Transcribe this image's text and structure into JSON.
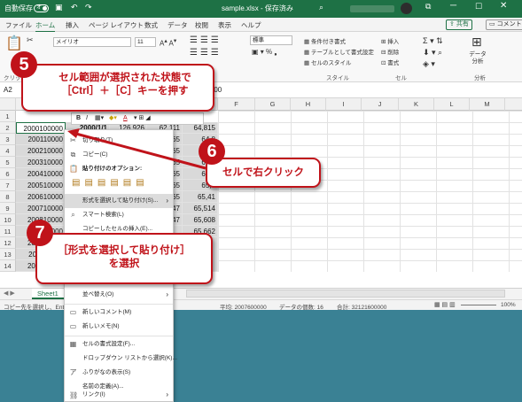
{
  "titlebar": {
    "autosave_label": "自動保存",
    "autosave_state": "オフ",
    "filename": "sample.xlsx - 保存済み"
  },
  "tabs": [
    "ファイル",
    "ホーム",
    "挿入",
    "ページ レイアウト",
    "数式",
    "データ",
    "校閲",
    "表示",
    "ヘルプ"
  ],
  "share_label": "共有",
  "comment_label": "コメント",
  "ribbon": {
    "font_name": "メイリオ",
    "font_size": "11",
    "number_format": "標準",
    "style_items": [
      "条件付き書式",
      "テーブルとして書式設定",
      "セルのスタイル"
    ],
    "style_group": "スタイル",
    "cell_items": [
      "挿入",
      "削除",
      "書式"
    ],
    "cell_group": "セル",
    "analysis_label": "データ分析",
    "analysis_group": "分析",
    "clipboard_group": "クリップボード"
  },
  "formula_bar": {
    "name_box": "A2",
    "value": "00000"
  },
  "columns": [
    "F",
    "G",
    "H",
    "I",
    "J",
    "K",
    "L",
    "M"
  ],
  "row_numbers": [
    "1",
    "2",
    "3",
    "4",
    "5",
    "6",
    "7",
    "8",
    "9",
    "10",
    "11",
    "12",
    "13",
    "14"
  ],
  "cells": {
    "row2": [
      "2000100000",
      "2000/1/1",
      "126,926",
      "62,111",
      "64,815"
    ],
    "col_a": [
      "200110000",
      "200210000",
      "200310000",
      "200410000",
      "200510000",
      "200610000",
      "200710000",
      "200810000",
      "200910000",
      "201010000",
      "201110000",
      "201210000"
    ],
    "col_e": [
      "64,8",
      "65,0",
      "65,2",
      "65,3",
      "65,4",
      "65,41",
      "65,514",
      "65,608",
      "65,662"
    ],
    "col_d_fragment": [
      "65",
      "65",
      "65",
      "65",
      "65",
      "65",
      "64,047",
      "64,047"
    ]
  },
  "minibar": {
    "bold": "B",
    "italic": "I",
    "font_color_glyph": "A"
  },
  "context_menu": {
    "cut": "切り取り(T)",
    "copy": "コピー(C)",
    "paste_options": "貼り付けのオプション:",
    "paste_special": "形式を選択して貼り付け(S)...",
    "smart_lookup": "スマート検索(L)",
    "copied_cell_insert": "コピーしたセルの挿入(E)...",
    "sort": "並べ替え(O)",
    "new_comment": "新しいコメント(M)",
    "new_note": "新しいメモ(N)",
    "format_cells": "セルの書式設定(F)...",
    "dropdown_pick": "ドロップダウン リストから選択(K)...",
    "phonetic": "ふりがなの表示(S)",
    "define_name": "名前の定義(A)...",
    "link": "リンク(I)"
  },
  "sheet_tab": "Sheet1",
  "status": {
    "left": "コピー先を選択し、Enter",
    "average": "平均: 2007600000",
    "count": "データの個数: 16",
    "sum": "合計: 32121600000",
    "zoom": "100%"
  },
  "callouts": {
    "step5_num": "5",
    "step5_text": "セル範囲が選択された状態で［Ctrl］＋［C］キーを押す",
    "step6_num": "6",
    "step6_text": "セルで右クリック",
    "step7_num": "7",
    "step7_line1": "［形式を選択して貼り付け］",
    "step7_line2": "を選択"
  },
  "colors": {
    "excel_green": "#1e7145",
    "callout_red": "#c0131a",
    "selection_gray": "#d9d9d9",
    "background_teal": "#3a8194"
  },
  "icons": [
    "undo-icon",
    "redo-icon",
    "search-icon",
    "share-icon",
    "comment-icon",
    "cut-icon",
    "copy-icon",
    "paste-icon",
    "smart-lookup-icon",
    "sort-icon",
    "comment-icon",
    "note-icon",
    "format-cells-icon",
    "phonetic-icon",
    "link-icon"
  ]
}
